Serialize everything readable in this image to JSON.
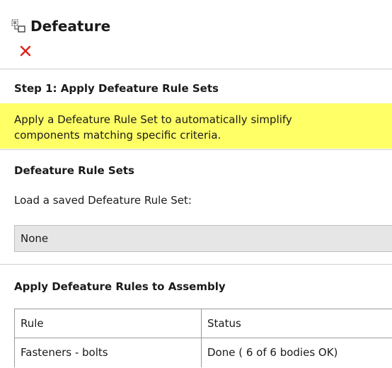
{
  "header": {
    "title": "Defeature",
    "close_icon": "close-icon",
    "title_icon": "defeature-icon",
    "close_color": "#e0201a"
  },
  "step1": {
    "heading": "Step 1: Apply Defeature Rule Sets",
    "hint_line1": "Apply a Defeature Rule Set to automatically simplify",
    "hint_line2": "components matching specific criteria.",
    "hint_color": "#ffff66"
  },
  "rule_sets": {
    "heading": "Defeature Rule Sets",
    "load_label": "Load a saved Defeature Rule Set:",
    "selected": "None"
  },
  "apply": {
    "heading": "Apply Defeature Rules to Assembly",
    "columns": [
      "Rule",
      "Status"
    ],
    "rows": [
      {
        "rule": "Fasteners - bolts",
        "status": "Done ( 6 of  6 bodies OK)"
      }
    ]
  }
}
